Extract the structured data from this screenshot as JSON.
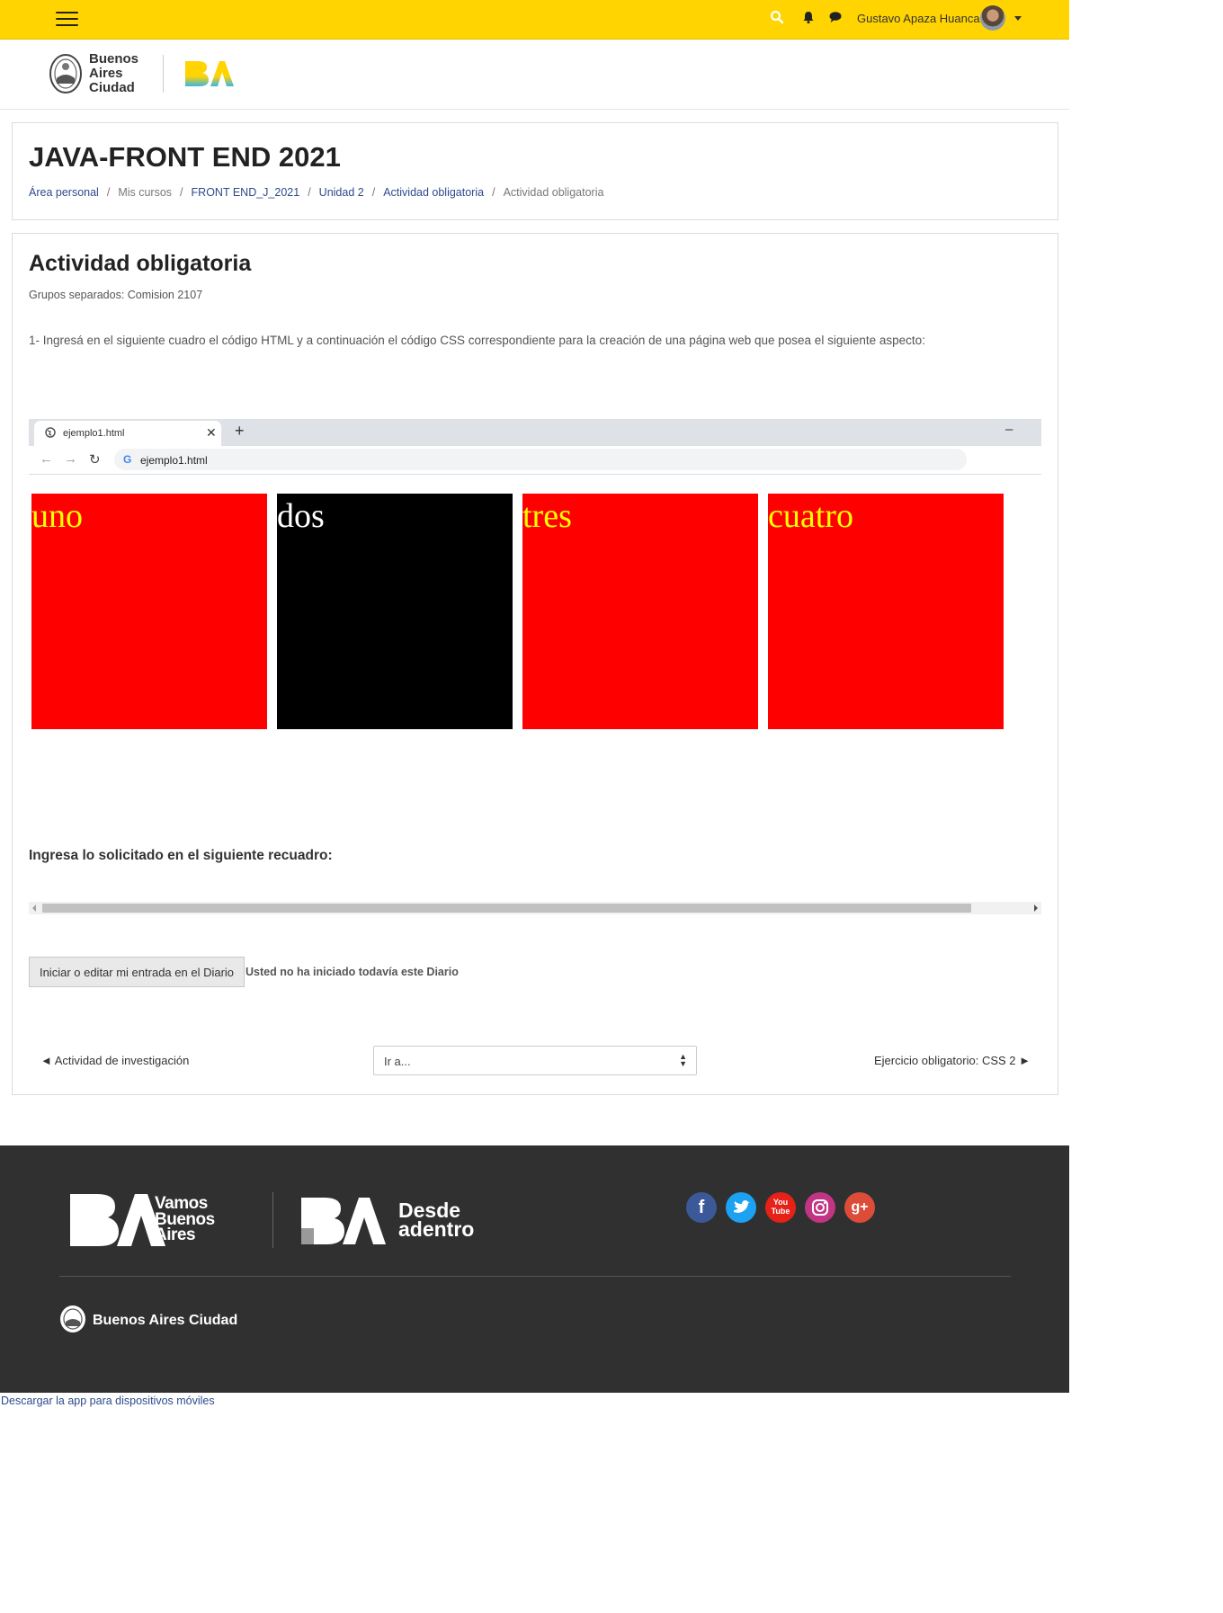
{
  "navbar": {
    "user_name": "Gustavo Apaza Huanca",
    "bg_color": "#ffd400"
  },
  "header": {
    "city_logo_lines": [
      "Buenos",
      "Aires",
      "Ciudad"
    ]
  },
  "course": {
    "title": "JAVA-FRONT END 2021",
    "breadcrumb": [
      "Área personal",
      "Mis cursos",
      "FRONT END_J_2021",
      "Unidad 2",
      "Actividad obligatoria",
      "Actividad obligatoria"
    ]
  },
  "activity": {
    "title": "Actividad obligatoria",
    "groups": "Grupos separados: Comision 2107",
    "instruction": "1- Ingresá en el siguiente cuadro el código HTML y a continuación el código CSS correspondiente para la creación de una página web que posea el siguiente aspecto:"
  },
  "browser_mock": {
    "tab_title": "ejemplo1.html",
    "url": "ejemplo1.html",
    "boxes": [
      {
        "label": "uno",
        "bg": "#ff0000",
        "color": "#ffff00"
      },
      {
        "label": "dos",
        "bg": "#000000",
        "color": "#ffffff"
      },
      {
        "label": "tres",
        "bg": "#ff0000",
        "color": "#ffff00"
      },
      {
        "label": "cuatro",
        "bg": "#ff0000",
        "color": "#ffff00"
      }
    ]
  },
  "entry": {
    "prompt": "Ingresa lo solicitado en el siguiente recuadro:",
    "button_label": "Iniciar o editar mi entrada en el Diario",
    "status": "Usted no ha iniciado todavía este Diario"
  },
  "activity_nav": {
    "prev_label": "◄ Actividad de investigación",
    "jump_placeholder": "Ir a...",
    "next_label": "Ejercicio obligatorio: CSS 2 ►"
  },
  "footer": {
    "vamos_lines": [
      "Vamos",
      "Buenos",
      "Aires"
    ],
    "desde_lines": [
      "Desde",
      "adentro"
    ],
    "city_name": "Buenos Aires Ciudad",
    "socials": [
      {
        "name": "facebook-icon",
        "glyph": "f",
        "color": "#3b5998"
      },
      {
        "name": "twitter-icon",
        "glyph": "t",
        "color": "#1da1f2"
      },
      {
        "name": "youtube-icon",
        "glyph": "You\nTube",
        "color": "#e62117"
      },
      {
        "name": "instagram-icon",
        "glyph": "◎",
        "color": "#c13584"
      },
      {
        "name": "google-plus-icon",
        "glyph": "g+",
        "color": "#dd4b39"
      }
    ]
  },
  "mobile_app_link": "Descargar la app para dispositivos móviles"
}
